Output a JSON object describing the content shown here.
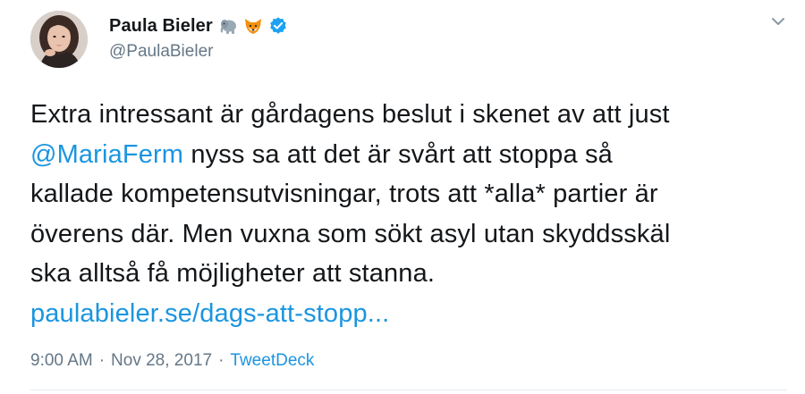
{
  "tweet": {
    "author": {
      "display_name": "Paula Bieler",
      "handle": "@PaulaBieler",
      "emojis": [
        "elephant-emoji",
        "fox-emoji"
      ],
      "verified_icon": "verified-badge-icon"
    },
    "menu_icon": "chevron-down-icon",
    "text": {
      "line1": "Extra intressant är gårdagens beslut i skenet av att just",
      "mention": "@MariaFerm",
      "line2_rest": " nyss sa att det är svårt att stoppa så",
      "line3": "kallade kompetensutvisningar, trots att *alla* partier är",
      "line4": "överens där. Men vuxna som sökt asyl utan skyddsskäl",
      "line5": "ska alltså få möjligheter att stanna.",
      "link": "paulabieler.se/dags-att-stopp..."
    },
    "meta": {
      "time": "9:00 AM",
      "separator1": "·",
      "date": "Nov 28, 2017",
      "separator2": "·",
      "source": "TweetDeck"
    },
    "colors": {
      "link": "#1b95e0",
      "secondary_text": "#657786",
      "primary_text": "#14171a",
      "verified": "#1da1f2"
    }
  }
}
